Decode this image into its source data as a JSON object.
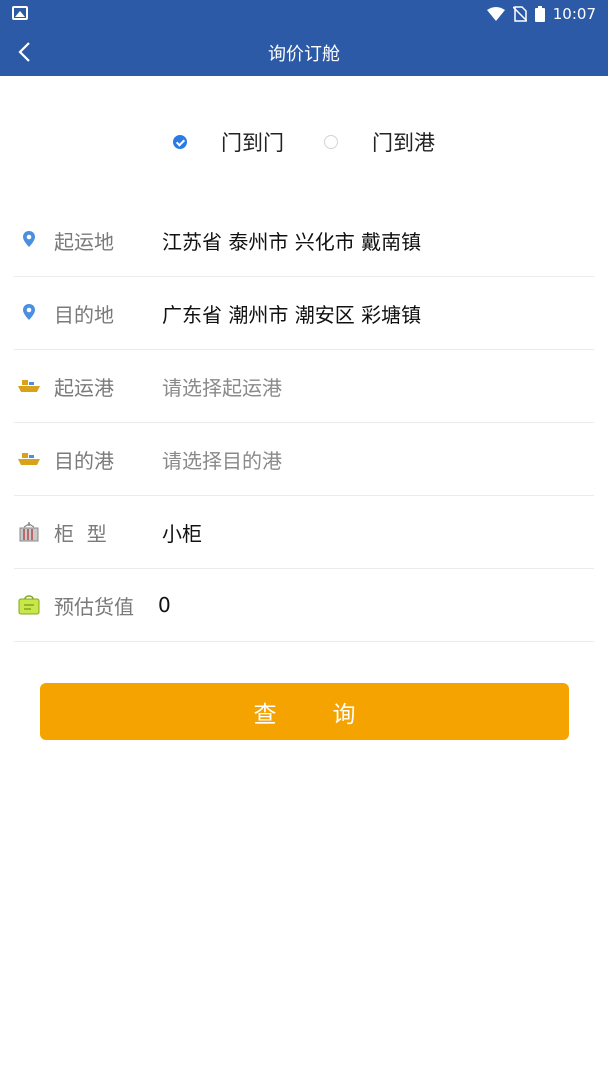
{
  "status": {
    "time": "10:07"
  },
  "header": {
    "title": "询价订舱"
  },
  "radios": [
    {
      "label": "门到门",
      "checked": true
    },
    {
      "label": "门到港",
      "checked": false
    }
  ],
  "form": {
    "origin": {
      "label": "起运地",
      "value": "江苏省 泰州市 兴化市 戴南镇"
    },
    "destination": {
      "label": "目的地",
      "value": "广东省 潮州市 潮安区 彩塘镇"
    },
    "origin_port": {
      "label": "起运港",
      "placeholder": "请选择起运港"
    },
    "dest_port": {
      "label": "目的港",
      "placeholder": "请选择目的港"
    },
    "container": {
      "label": "柜  型",
      "value": "小柜"
    },
    "goods_value": {
      "label": "预估货值",
      "value": "0"
    }
  },
  "submit_label": "查询",
  "colors": {
    "primary": "#2c5aa7",
    "accent": "#f5a300",
    "radio": "#2c7be5"
  }
}
